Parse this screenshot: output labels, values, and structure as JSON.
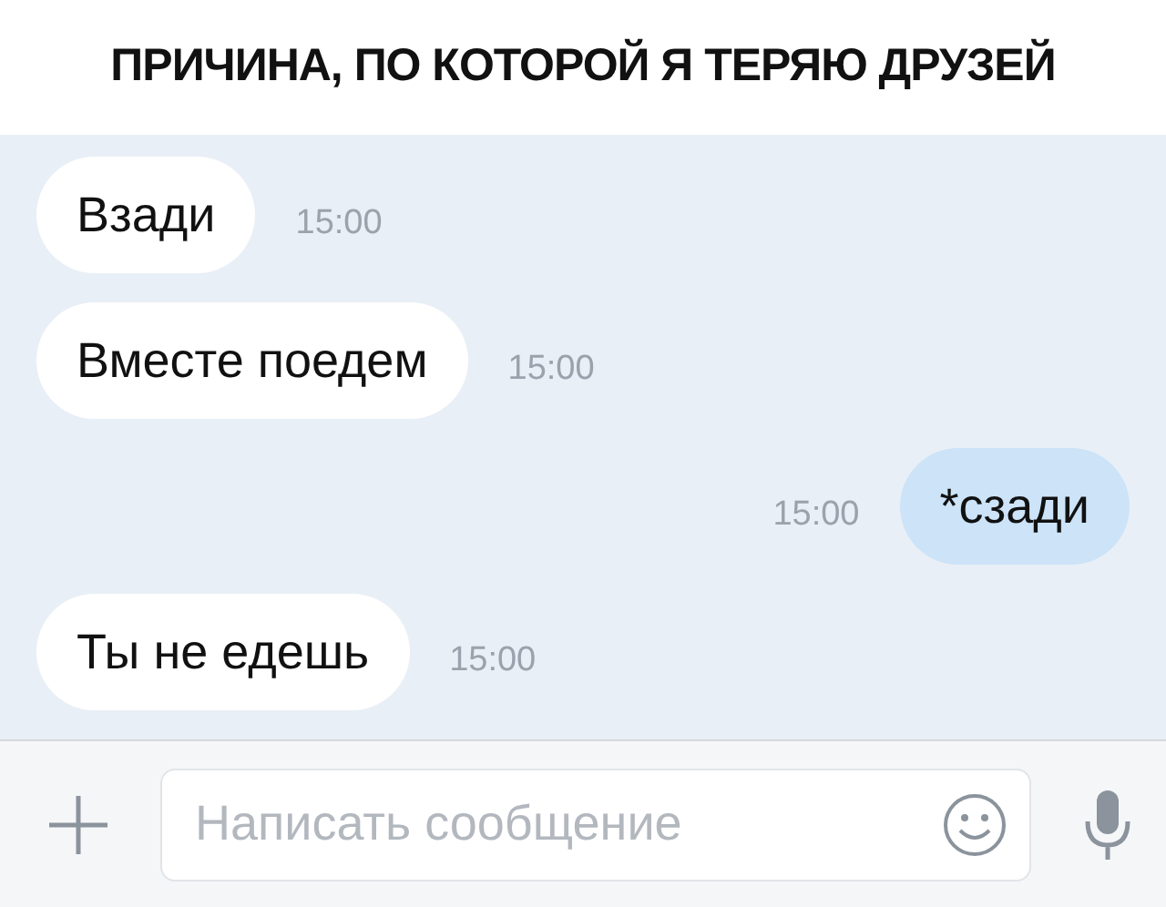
{
  "caption": "ПРИЧИНА, ПО КОТОРОЙ Я ТЕРЯЮ ДРУЗЕЙ",
  "messages": [
    {
      "text": "Взади",
      "time": "15:00",
      "outgoing": false
    },
    {
      "text": "Вместе поедем",
      "time": "15:00",
      "outgoing": false
    },
    {
      "text": "*сзади",
      "time": "15:00",
      "outgoing": true
    },
    {
      "text": "Ты не едешь",
      "time": "15:00",
      "outgoing": false
    }
  ],
  "composer": {
    "placeholder": "Написать сообщение"
  }
}
